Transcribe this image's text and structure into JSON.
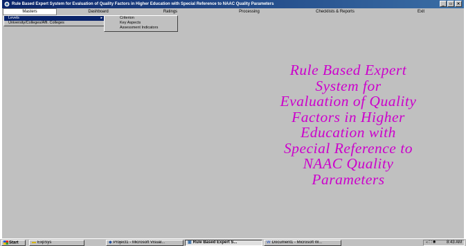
{
  "window": {
    "title": "Rule Based Expert System for Evaluation of Quality Factors in Higher Education with Special Reference to NAAC Quality Parameters",
    "controls": {
      "minimize": "_",
      "maximize": "▫",
      "close": "×"
    }
  },
  "menubar": {
    "items": [
      "Masters",
      "Dashboard",
      "Ratings",
      "Processing",
      "Checklists & Reports",
      "Exit"
    ]
  },
  "masters_menu": {
    "items": [
      "Levels",
      "University/Colleges/Affi. Colleges"
    ],
    "submenu_arrow": "▸"
  },
  "levels_submenu": {
    "items": [
      "Criterion",
      "Key Aspects",
      "Assessment Indicators"
    ]
  },
  "main": {
    "heading_lines": [
      "Rule Based Expert",
      "System for",
      "Evaluation of Quality",
      "Factors in Higher",
      "Education with",
      "Special Reference to",
      "NAAC Quality",
      "Parameters"
    ],
    "heading_color": "#cc00cc"
  },
  "taskbar": {
    "start_label": "Start",
    "buttons": [
      {
        "label": "ExpSys",
        "icon": "folder-icon"
      },
      {
        "label": "Project1 - Microsoft Visual...",
        "icon": "vb-icon"
      },
      {
        "label": "Rule Based Expert S...",
        "icon": "app-icon"
      },
      {
        "label": "Document1 - Microsoft W...",
        "icon": "word-icon"
      }
    ],
    "tray": {
      "icons": "« ⛶ ◉",
      "time": "8:43 AM"
    }
  }
}
